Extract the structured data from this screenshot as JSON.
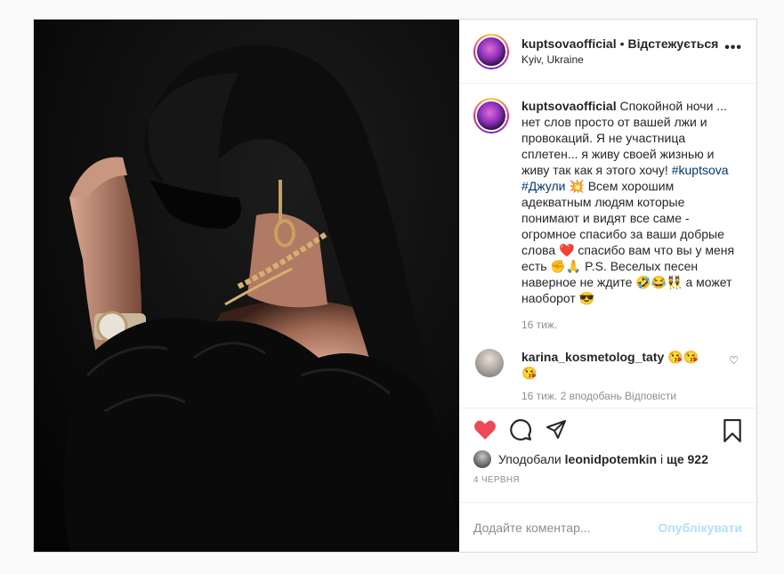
{
  "header": {
    "username": "kuptsovaofficial",
    "separator": "•",
    "follow_status": "Відстежується",
    "location": "Kyiv, Ukraine",
    "more_label": "•••"
  },
  "caption": {
    "username": "kuptsovaofficial",
    "text_1": "Спокойной ночи ... нет слов просто от вашей лжи и провокаций. Я не участница сплетен... я живу своей жизнью и живу так как я этого хочу!",
    "hashtag_1": "#kuptsova",
    "hashtag_2": "#Джули",
    "emoji_1": "💥",
    "text_2": "Всем хорошим адекватным людям которые понимают и видят все саме - огромное спасибо за ваши добрые слова",
    "emoji_2": "❤️",
    "text_3": "спасибо вам что вы у меня есть",
    "emoji_3": "✊🙏",
    "text_4": "P.S. Веселых песен наверное не ждите",
    "emoji_4": "🤣😂👯",
    "text_5": "а может наоборот",
    "emoji_5": "😎",
    "time": "16 тиж."
  },
  "comment": {
    "username": "karina_kosmetolog_taty",
    "emoji": "😘😘😘",
    "meta": "16 тиж.   2 вподобань   Відповісти"
  },
  "likes": {
    "prefix": "Уподобали",
    "user": "leonidpotemkin",
    "middle": "і",
    "count": "ще 922"
  },
  "date": "4 ЧЕРВНЯ",
  "add_comment": {
    "placeholder": "Додайте коментар...",
    "post_label": "Опублікувати"
  },
  "colors": {
    "like_red": "#ed4956",
    "link_blue": "#00376b",
    "post_button": "#b2dffc"
  }
}
